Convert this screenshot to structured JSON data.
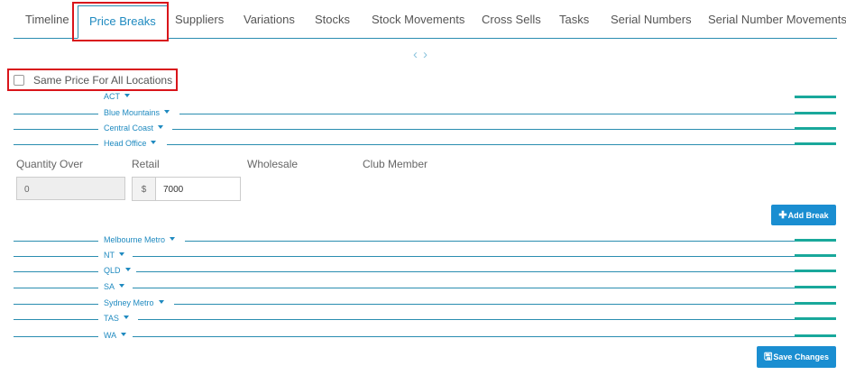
{
  "tabs": [
    {
      "label": "Timeline"
    },
    {
      "label": "Price Breaks",
      "active": true
    },
    {
      "label": "Suppliers"
    },
    {
      "label": "Variations"
    },
    {
      "label": "Stocks"
    },
    {
      "label": "Stock Movements"
    },
    {
      "label": "Cross Sells"
    },
    {
      "label": "Tasks"
    },
    {
      "label": "Serial Numbers"
    },
    {
      "label": "Serial Number Movements"
    }
  ],
  "pager": {
    "prev_icon": "chevron-left-icon",
    "next_icon": "chevron-right-icon",
    "prev": "‹",
    "next": "›"
  },
  "same_price": {
    "label": "Same Price For All Locations",
    "checked": false
  },
  "locations_top": [
    "ACT",
    "Blue Mountains",
    "Central Coast",
    "Head Office"
  ],
  "price_table": {
    "headers": [
      "Quantity Over",
      "Retail",
      "Wholesale",
      "Club Member"
    ],
    "quantity_value": "0",
    "currency_prefix": "$",
    "retail_value": "7000"
  },
  "add_break_label": "Add Break",
  "locations_bottom": [
    "Melbourne Metro",
    "NT",
    "QLD",
    "SA",
    "Sydney Metro",
    "TAS",
    "WA"
  ],
  "save_label": "Save Changes",
  "colors": {
    "accent": "#1a8ed1",
    "line": "#2a8db0",
    "bar": "#19a89b",
    "highlight": "#d9151b"
  }
}
